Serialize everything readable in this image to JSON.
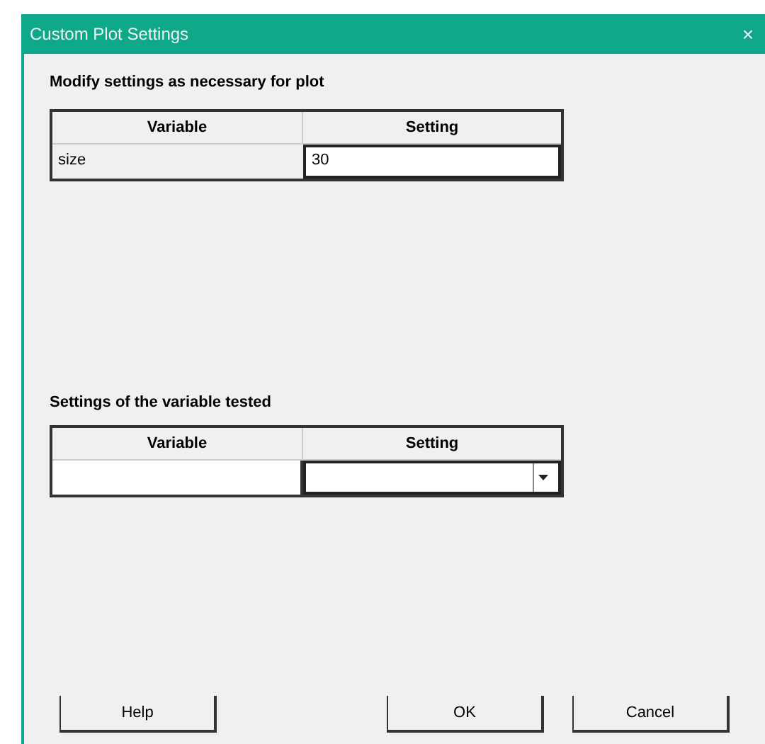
{
  "window": {
    "title": "Custom Plot Settings",
    "close": "×"
  },
  "section_1": {
    "label": "Modify settings as necessary for plot",
    "columns": [
      "Variable",
      "Setting"
    ],
    "rows": [
      {
        "variable": "size",
        "setting": "30"
      }
    ]
  },
  "section_2": {
    "label": "Settings of the variable tested",
    "columns": [
      "Variable",
      "Setting"
    ],
    "rows": [
      {
        "variable": "",
        "setting": ""
      }
    ]
  },
  "buttons": [
    {
      "label": "Help",
      "kind": "left"
    },
    {
      "label": "OK",
      "kind": "right"
    },
    {
      "label": "Cancel",
      "kind": "right"
    }
  ]
}
